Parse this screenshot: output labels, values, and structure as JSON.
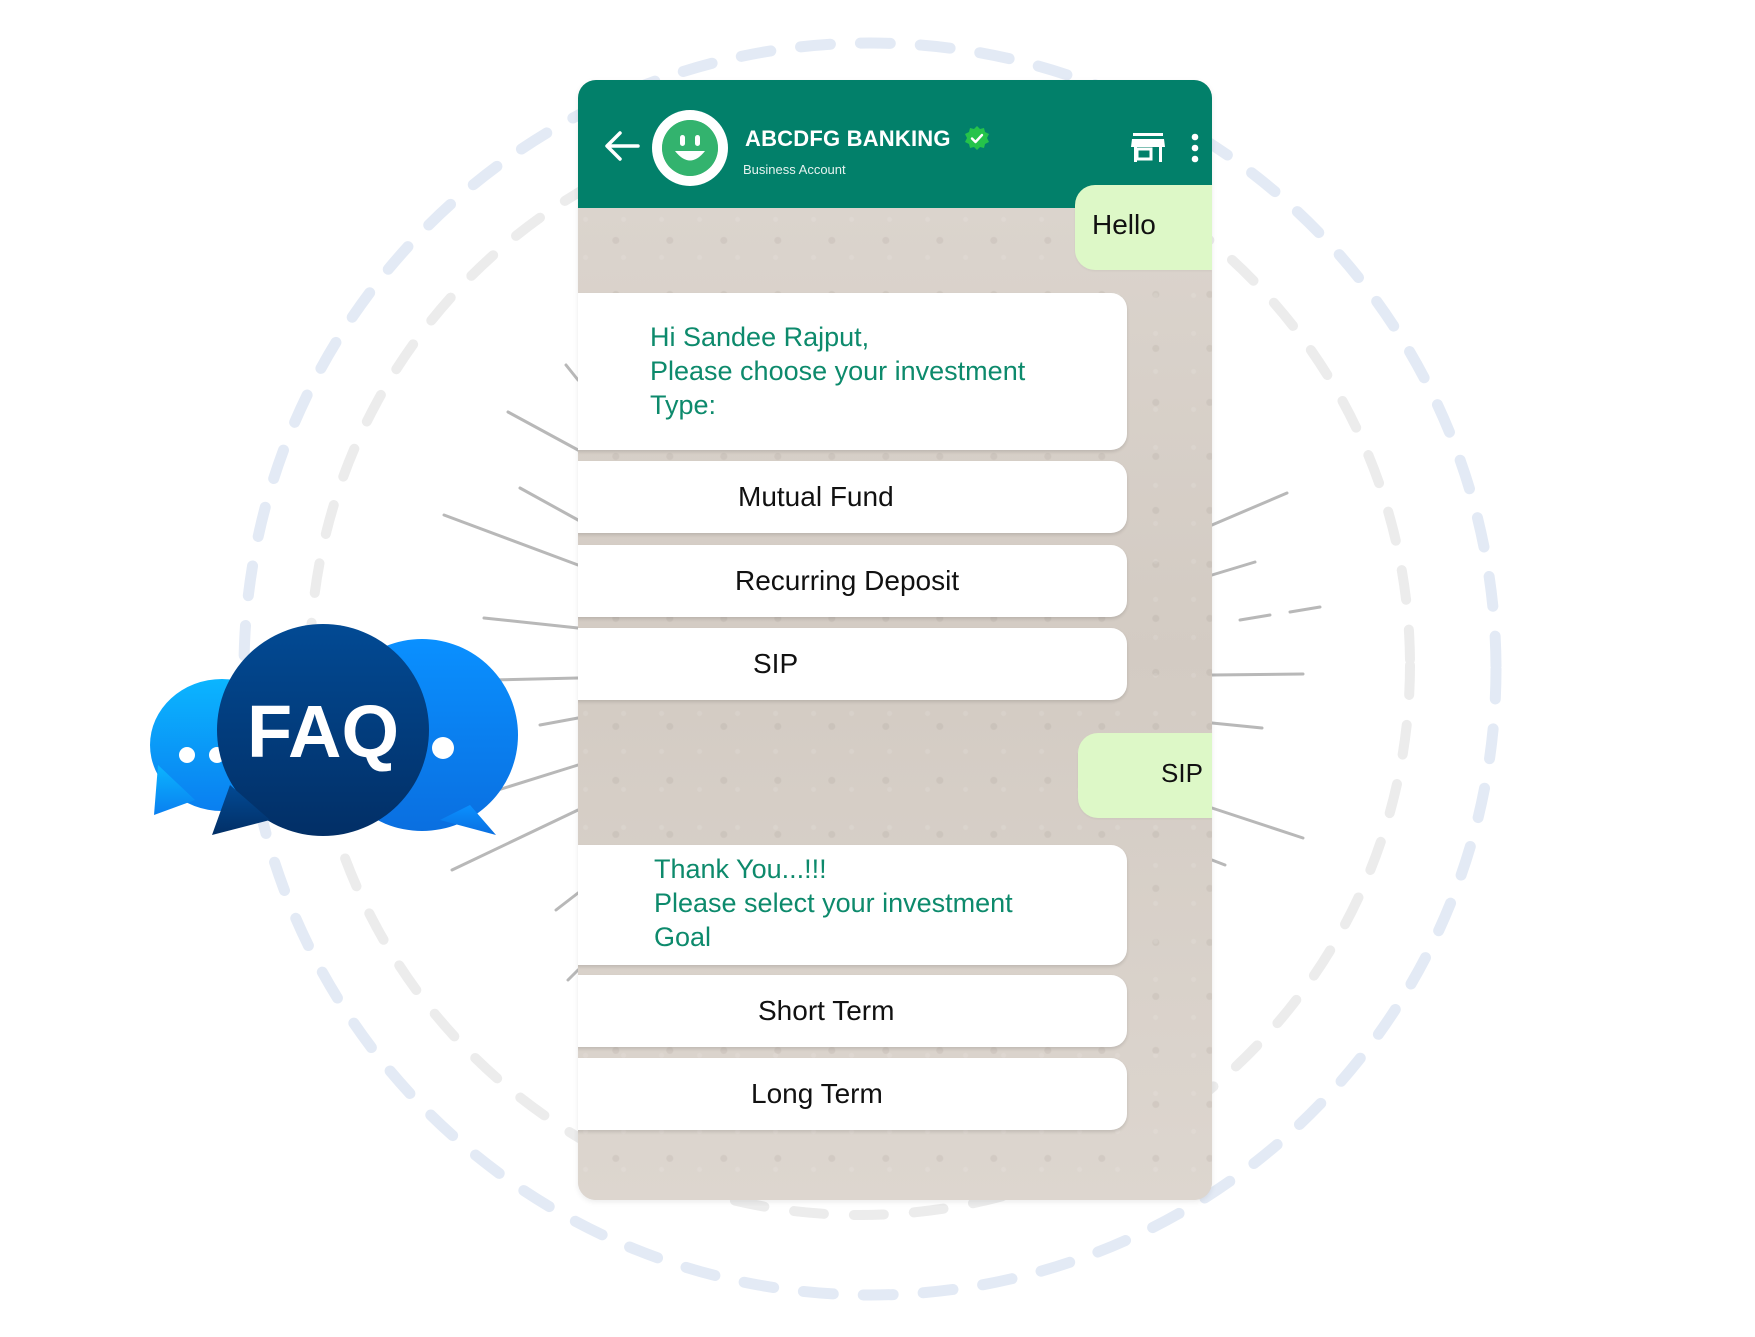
{
  "header": {
    "title": "ABCDFG BANKING",
    "subtitle": "Business Account",
    "back_icon": "arrow-left-icon",
    "avatar_icon": "smiley-face-icon",
    "verified_icon": "verified-badge-icon",
    "store_icon": "storefront-icon",
    "menu_icon": "more-vertical-icon"
  },
  "colors": {
    "header_bg": "#02806a",
    "avatar_green": "#33b36e",
    "verified_green": "#25c34a",
    "bot_text": "#0d8a6c",
    "outgoing_bubble": "#ddf8c7",
    "chat_bg": "#d8d1ca",
    "faq_dark": "#003d80",
    "faq_blue": "#0a84f0",
    "ring_outer": "#e3eaf5",
    "ring_inner": "#ececec"
  },
  "chat": {
    "user_message_1": "Hello",
    "bot_message_1": "Hi Sandee Rajput,\nPlease choose your investment\nType:",
    "options_1": [
      "Mutual Fund",
      "Recurring Deposit",
      "SIP"
    ],
    "user_message_2": "SIP",
    "bot_message_2": "Thank You...!!!\nPlease select your investment\nGoal",
    "options_2": [
      "Short Term",
      "Long Term"
    ]
  },
  "faq_badge": {
    "label": "FAQ"
  }
}
